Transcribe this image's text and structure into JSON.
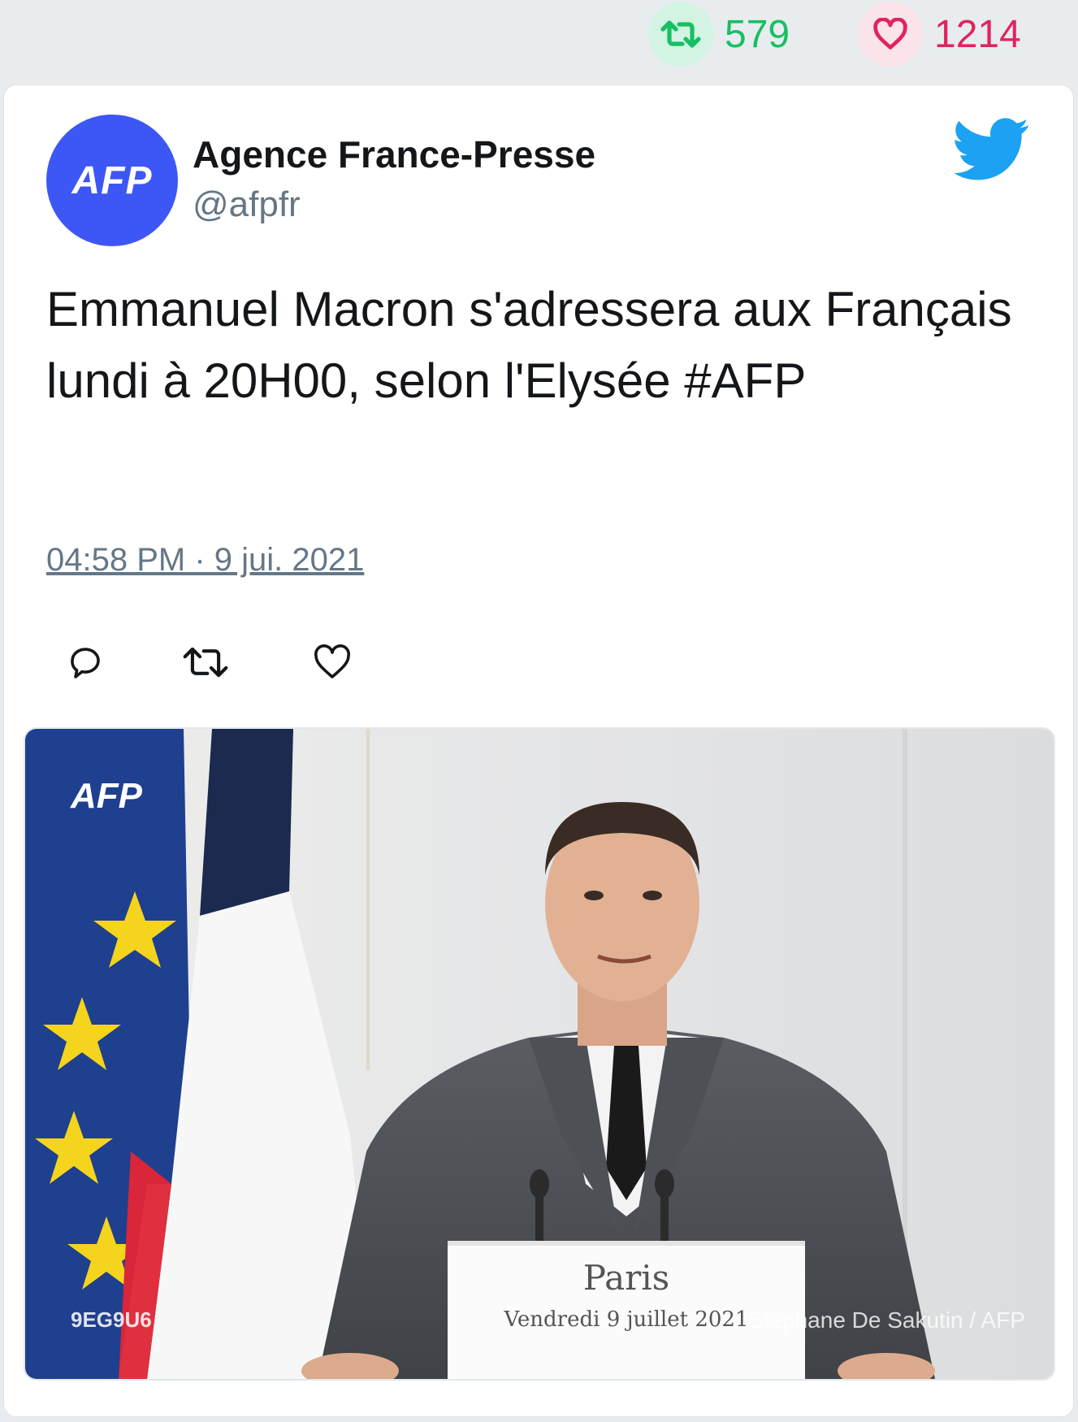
{
  "stats": {
    "retweets": "579",
    "likes": "1214"
  },
  "author": {
    "name": "Agence France-Presse",
    "handle": "@afpfr",
    "avatar_text": "AFP"
  },
  "tweet": {
    "text": "Emmanuel Macron s'adressera aux Français lundi à 20H00, selon l'Elysée #AFP",
    "timestamp": "04:58 PM · 9 jui. 2021"
  },
  "media": {
    "brand": "AFP",
    "photo_id": "9EG9U6",
    "credit": "Stephane De Sakutin / AFP",
    "podium_city": "Paris",
    "podium_date": "Vendredi 9 juillet 2021"
  },
  "colors": {
    "retweet": "#17bf63",
    "like": "#e0245e",
    "twitter_blue": "#1da1f2",
    "afp_blue": "#3c57f5"
  },
  "icons": [
    "retweet-icon",
    "heart-icon",
    "twitter-bird-icon",
    "reply-icon"
  ]
}
